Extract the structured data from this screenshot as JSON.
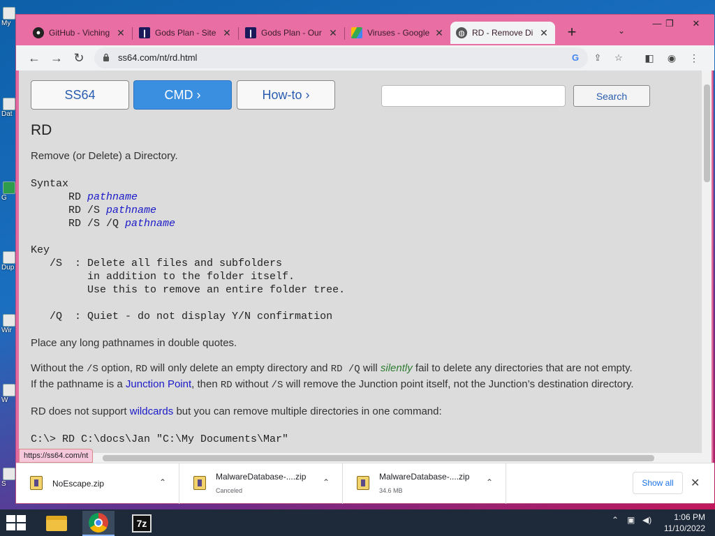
{
  "desktop": {
    "icons": [
      {
        "label": "My",
        "icon": "computer-icon"
      },
      {
        "label": "Dat",
        "icon": "database-icon"
      },
      {
        "label": "G",
        "icon": "app-icon"
      },
      {
        "label": "Dup",
        "icon": "app-icon"
      },
      {
        "label": "Wir",
        "icon": "app-icon"
      },
      {
        "label": "W",
        "icon": "app-icon"
      },
      {
        "label": "S",
        "icon": "app-icon"
      }
    ]
  },
  "browser": {
    "tabs": [
      {
        "title": "GitHub - Viching",
        "icon": "github-icon"
      },
      {
        "title": "Gods Plan - Site",
        "icon": "site-icon"
      },
      {
        "title": "Gods Plan - Our",
        "icon": "site-icon"
      },
      {
        "title": "Viruses - Google",
        "icon": "google-drive-icon"
      },
      {
        "title": "RD - Remove Di",
        "icon": "globe-icon",
        "active": true
      }
    ],
    "url": "ss64.com/nt/rd.html",
    "status_url": "https://ss64.com/nt"
  },
  "page": {
    "nav": {
      "home": "SS64",
      "cmd": "CMD ›",
      "howto": "How-to ›",
      "search_button": "Search",
      "search_value": ""
    },
    "title": "RD",
    "description": "Remove (or Delete) a Directory.",
    "syntax_label": "Syntax",
    "syntax_lines": [
      {
        "cmd": "RD ",
        "arg": "pathname"
      },
      {
        "cmd": "RD /S ",
        "arg": "pathname"
      },
      {
        "cmd": "RD /S /Q ",
        "arg": "pathname"
      }
    ],
    "key_label": "Key",
    "key_s_1": "   /S  : Delete all files and subfolders",
    "key_s_2": "         in addition to the folder itself.",
    "key_s_3": "         Use this to remove an entire folder tree.",
    "key_q": "   /Q  : Quiet - do not display Y/N confirmation",
    "para_quotes": "Place any long pathnames in double quotes.",
    "para2": {
      "t1": "Without the ",
      "c1": "/S",
      "t2": " option, ",
      "c2": "RD",
      "t3": " will only delete an empty directory and ",
      "c3": "RD /Q",
      "t4": " will ",
      "silently": "silently",
      "t5": " fail to delete any directories that are not empty.",
      "t6": "If the pathname is a ",
      "junction": "Junction Point",
      "t7": ", then ",
      "c4": "RD",
      "t8": " without ",
      "c5": "/S",
      "t9": " will remove the Junction point itself, not the Junction’s destination directory."
    },
    "para3": {
      "t1": "RD does not support ",
      "wildcards": "wildcards",
      "t2": " but you can remove multiple directories in one command:"
    },
    "example": "C:\\> RD C:\\docs\\Jan \"C:\\My Documents\\Mar\""
  },
  "downloads": {
    "items": [
      {
        "name": "NoEscape.zip",
        "sub": ""
      },
      {
        "name": "MalwareDatabase-....zip",
        "sub": "Canceled"
      },
      {
        "name": "MalwareDatabase-....zip",
        "sub": "34.6 MB"
      }
    ],
    "show_all": "Show all"
  },
  "taskbar": {
    "time": "1:06 PM",
    "date": "11/10/2022"
  }
}
